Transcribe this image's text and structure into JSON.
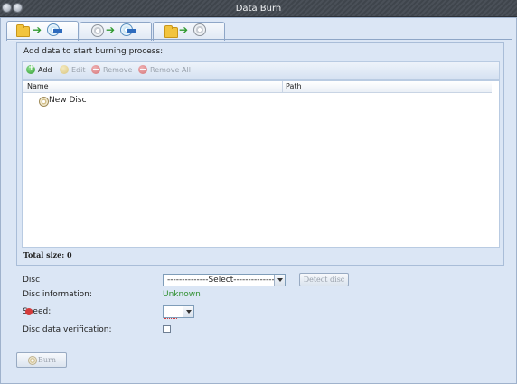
{
  "window": {
    "title": "Data Burn"
  },
  "tabs": [
    {
      "icon_from": "folder-icon",
      "icon_to": "dvd-disc-icon"
    },
    {
      "icon_from": "disc-icon",
      "icon_to": "dvd-disc-icon"
    },
    {
      "icon_from": "folder-icon",
      "icon_to": "disc-icon"
    }
  ],
  "panel": {
    "title": "Add data to start burning process:",
    "toolbar": {
      "add": "Add",
      "edit": "Edit",
      "remove": "Remove",
      "remove_all": "Remove All"
    },
    "columns": [
      "Name",
      "Path"
    ],
    "rows": [
      {
        "name": "New Disc",
        "path": ""
      }
    ],
    "total_size": "Total size: 0"
  },
  "form": {
    "disc_label": "Disc",
    "disc_select_value": "--------------Select--------------",
    "detect_disc": "Detect disc",
    "disc_info_label": "Disc information:",
    "disc_info_value": "Unknown",
    "speed_label": "Speed:",
    "verify_label": "Disc data verification:",
    "burn_button": "Burn"
  },
  "colors": {
    "status_green": "#2f8f2f",
    "accent_blue": "#2e6bbd",
    "error_red": "#d53c3c"
  }
}
